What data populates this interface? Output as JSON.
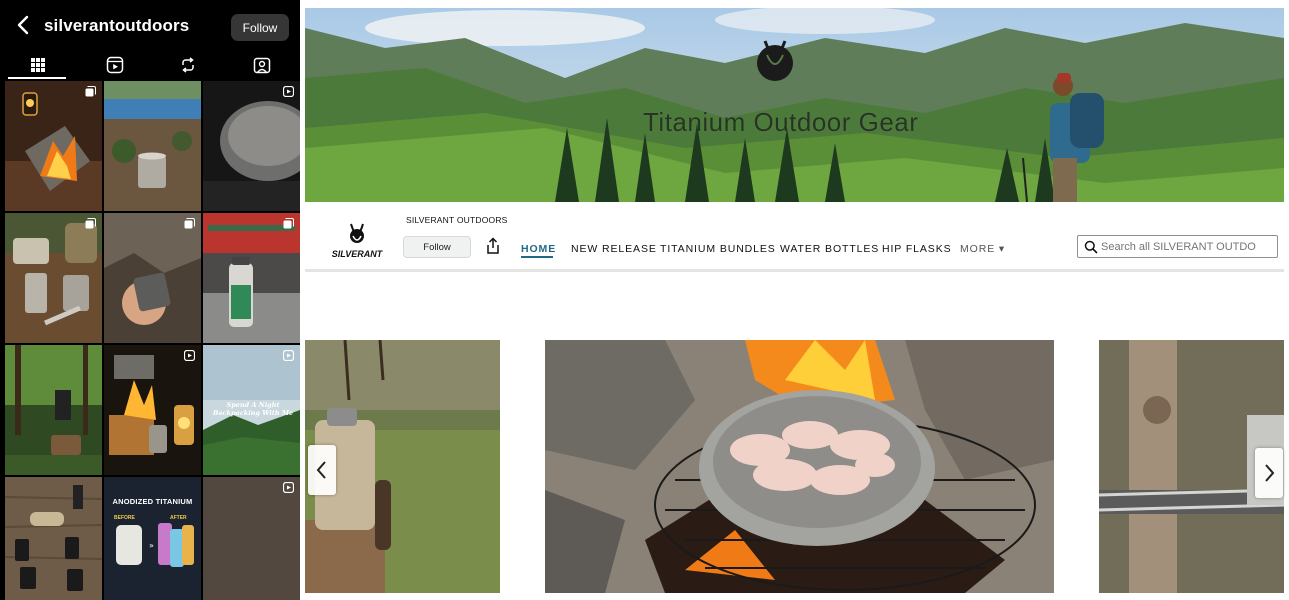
{
  "instagram": {
    "username": "silverantoutdoors",
    "follow_label": "Follow",
    "tabs": [
      "grid-icon",
      "reels-icon",
      "reposts-icon",
      "tagged-icon"
    ],
    "tiles": [
      {
        "name": "tile-campfire-lantern",
        "badge": "carousel-icon"
      },
      {
        "name": "tile-lake-cup",
        "badge": ""
      },
      {
        "name": "tile-titanium-pot",
        "badge": "reel-icon"
      },
      {
        "name": "tile-cookware-set",
        "badge": "carousel-icon"
      },
      {
        "name": "tile-cave-mug",
        "badge": "carousel-icon"
      },
      {
        "name": "tile-temple-bottle",
        "badge": "carousel-icon"
      },
      {
        "name": "tile-forest-stove",
        "badge": ""
      },
      {
        "name": "tile-night-fire",
        "badge": "reel-icon"
      },
      {
        "name": "tile-backpacking-promo",
        "badge": "reel-icon"
      },
      {
        "name": "tile-table-gear",
        "badge": ""
      },
      {
        "name": "tile-anodized-titanium",
        "badge": ""
      },
      {
        "name": "tile-metal-texture",
        "badge": "reel-icon"
      }
    ],
    "promo_backpacking": {
      "line1": "Spend A Night",
      "line2": "Backpacking With Me"
    },
    "promo_anodized": {
      "title": "ANODIZED TITANIUM",
      "before": "BEFORE",
      "after": "AFTER"
    }
  },
  "store": {
    "hero_title": "Titanium Outdoor Gear",
    "brand_name": "SILVERANT OUTDOORS",
    "logo_text": "SILVERANT",
    "follow_label": "Follow",
    "nav": {
      "home": "HOME",
      "new_release": "NEW RELEASE",
      "titanium_bundles": "TITANIUM BUNDLES",
      "water_bottles": "WATER BOTTLES",
      "hip_flasks": "HIP FLASKS",
      "more": "MORE ▾"
    },
    "search_placeholder": "Search all SILVERANT OUTDO",
    "accent_color": "#1f6b86"
  }
}
